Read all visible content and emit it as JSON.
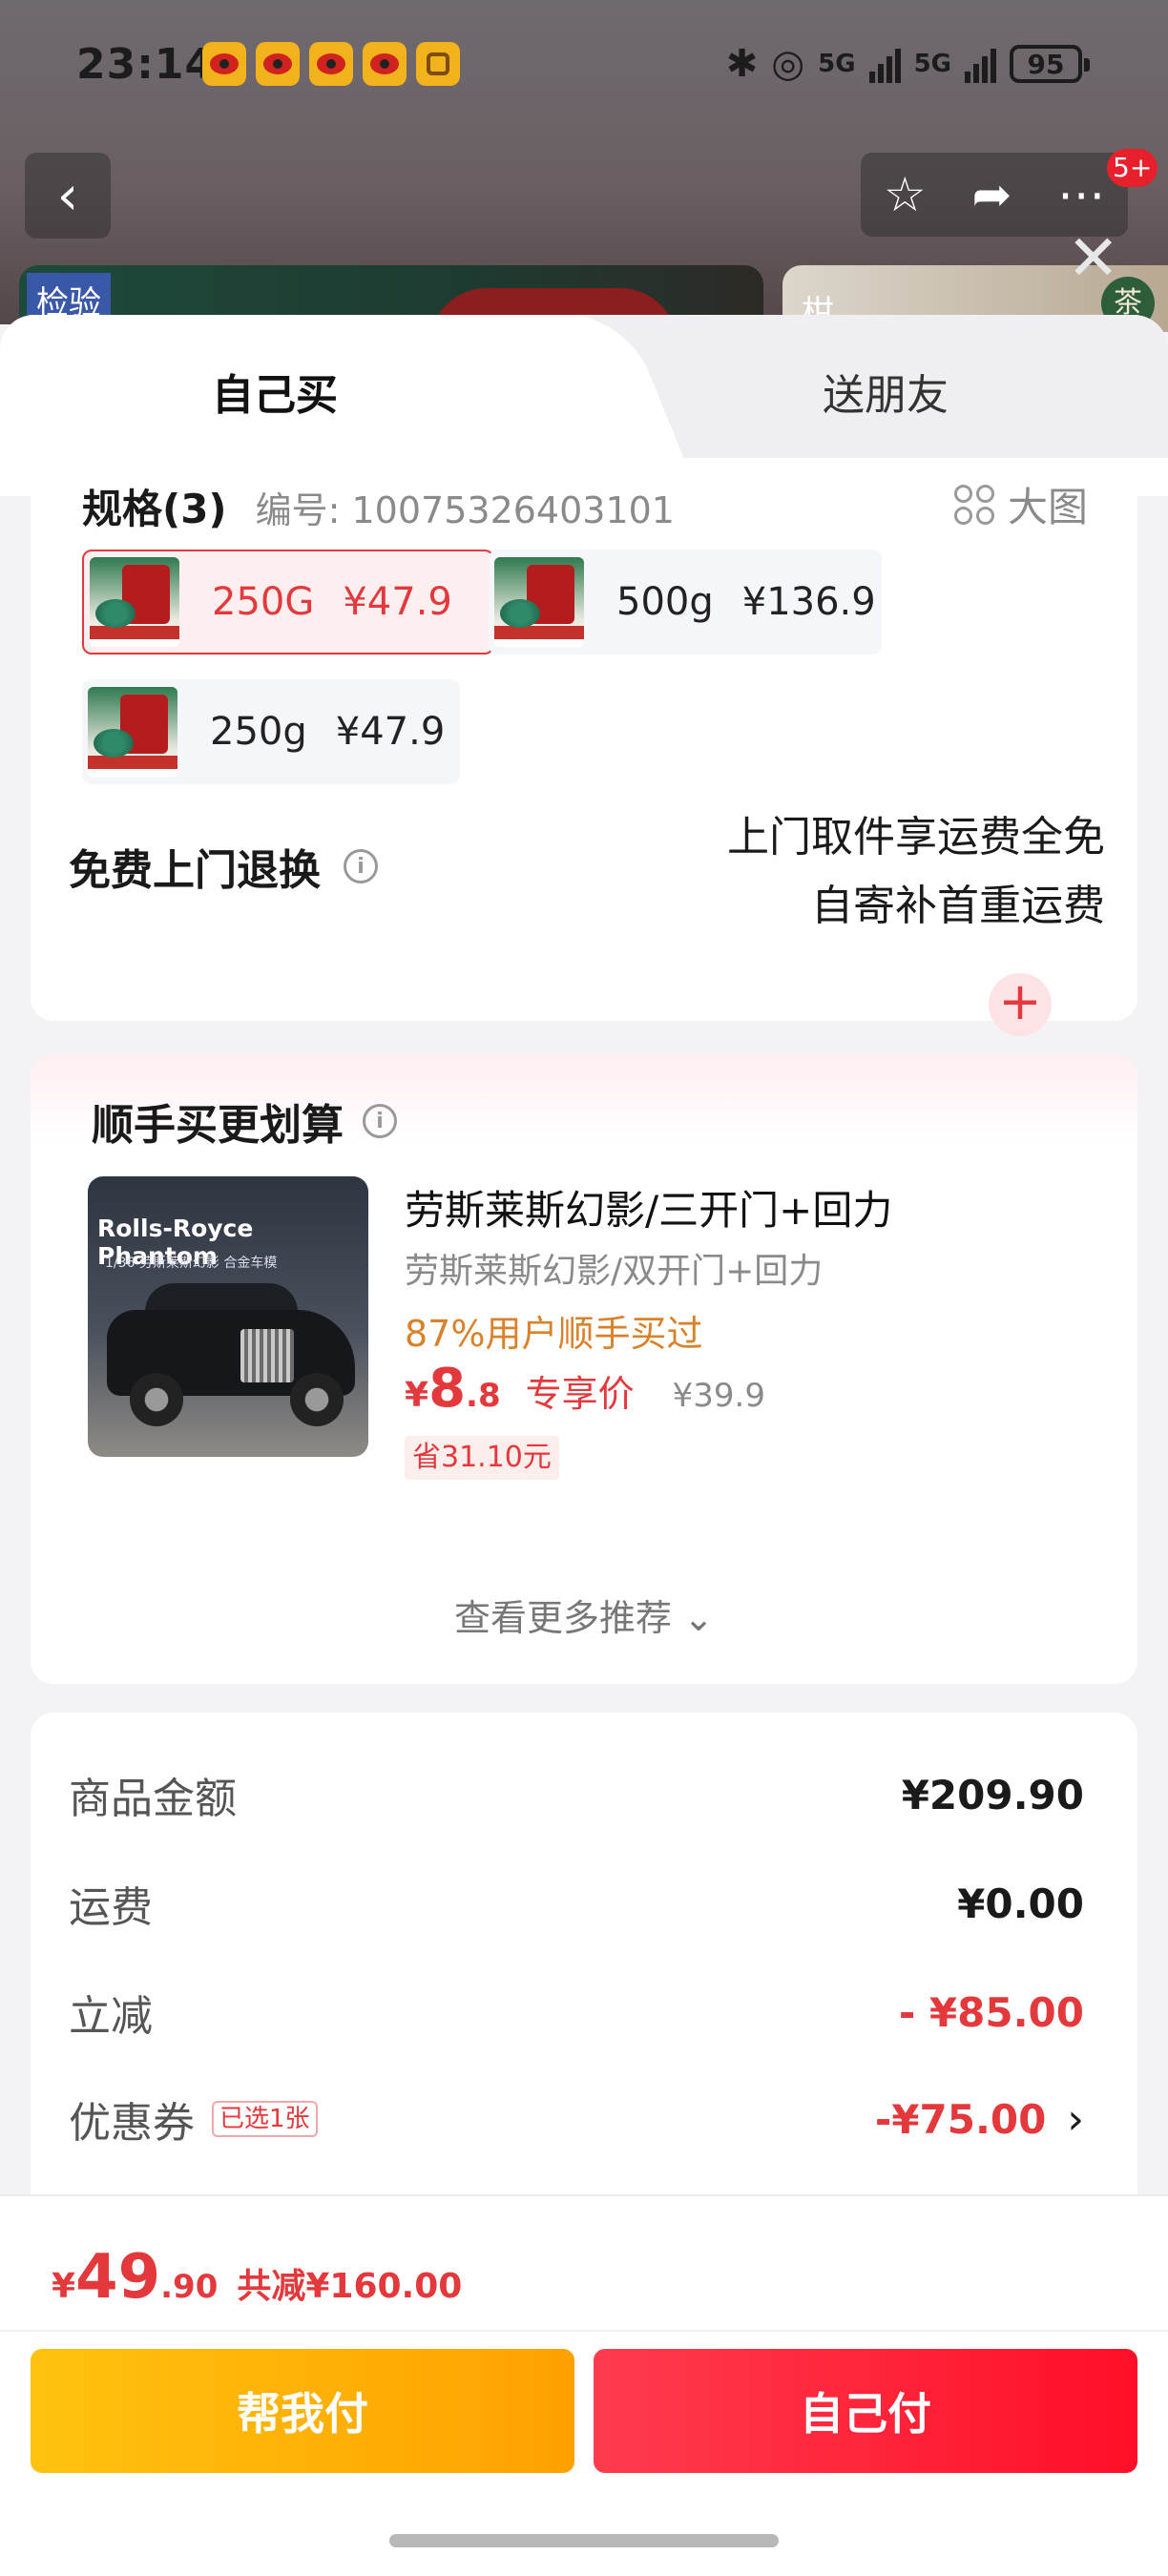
{
  "status_bar": {
    "time": "23:14",
    "notifications": [
      "weibo-icon",
      "weibo-icon",
      "weibo-icon",
      "weibo-icon",
      "honeycomb-icon"
    ],
    "signal_1": "5G",
    "signal_2": "5G",
    "battery": "95"
  },
  "background_page": {
    "nav_badge": "5+",
    "left_thumb_tag": "检验",
    "right_thumb_text": "柑",
    "right_thumb_tag": "茶"
  },
  "tabs": [
    {
      "label": "自己买",
      "active": true
    },
    {
      "label": "送朋友",
      "active": false
    }
  ],
  "spec": {
    "title": "规格(3)",
    "code": "编号: 10075326403101",
    "big_image": "大图",
    "options": [
      {
        "name": "250G",
        "price": "¥47.9",
        "selected": true
      },
      {
        "name": "500g",
        "price": "¥136.9",
        "selected": false
      },
      {
        "name": "250g",
        "price": "¥47.9",
        "selected": false
      }
    ]
  },
  "return_service": {
    "title": "免费上门退换",
    "line1": "上门取件享运费全免",
    "line2": "自寄补首重运费"
  },
  "recommend": {
    "title": "顺手买更划算",
    "image_brand": "Rolls-Royce Phantom",
    "image_sub": "1/36 劳斯莱斯幻影 合金车模",
    "name": "劳斯莱斯幻影/三开门+回力",
    "variant": "劳斯莱斯幻影/双开门+回力",
    "users": "87%用户顺手买过",
    "price_currency": "¥",
    "price_int": "8",
    "price_dec": ".8",
    "price_label": "专享价",
    "original_price": "¥39.9",
    "saving": "省31.10元",
    "more": "查看更多推荐 ⌄"
  },
  "price_detail": {
    "goods_label": "商品金额",
    "goods_value": "¥209.90",
    "shipping_label": "运费",
    "shipping_value": "¥0.00",
    "discount_label": "立减",
    "discount_value": "- ¥85.00",
    "coupon_label": "优惠券",
    "coupon_badge": "已选1张",
    "coupon_value": "-¥75.00"
  },
  "bottom": {
    "total_currency": "¥",
    "total_int": "49",
    "total_dec": ".90",
    "total_saved": "共减¥160.00",
    "help_pay": "帮我付",
    "self_pay": "自己付"
  },
  "colors": {
    "accent_red": "#e4393c",
    "orange": "#d9822b",
    "help_button": "#ffb300",
    "pay_button": "#ff1f35"
  }
}
